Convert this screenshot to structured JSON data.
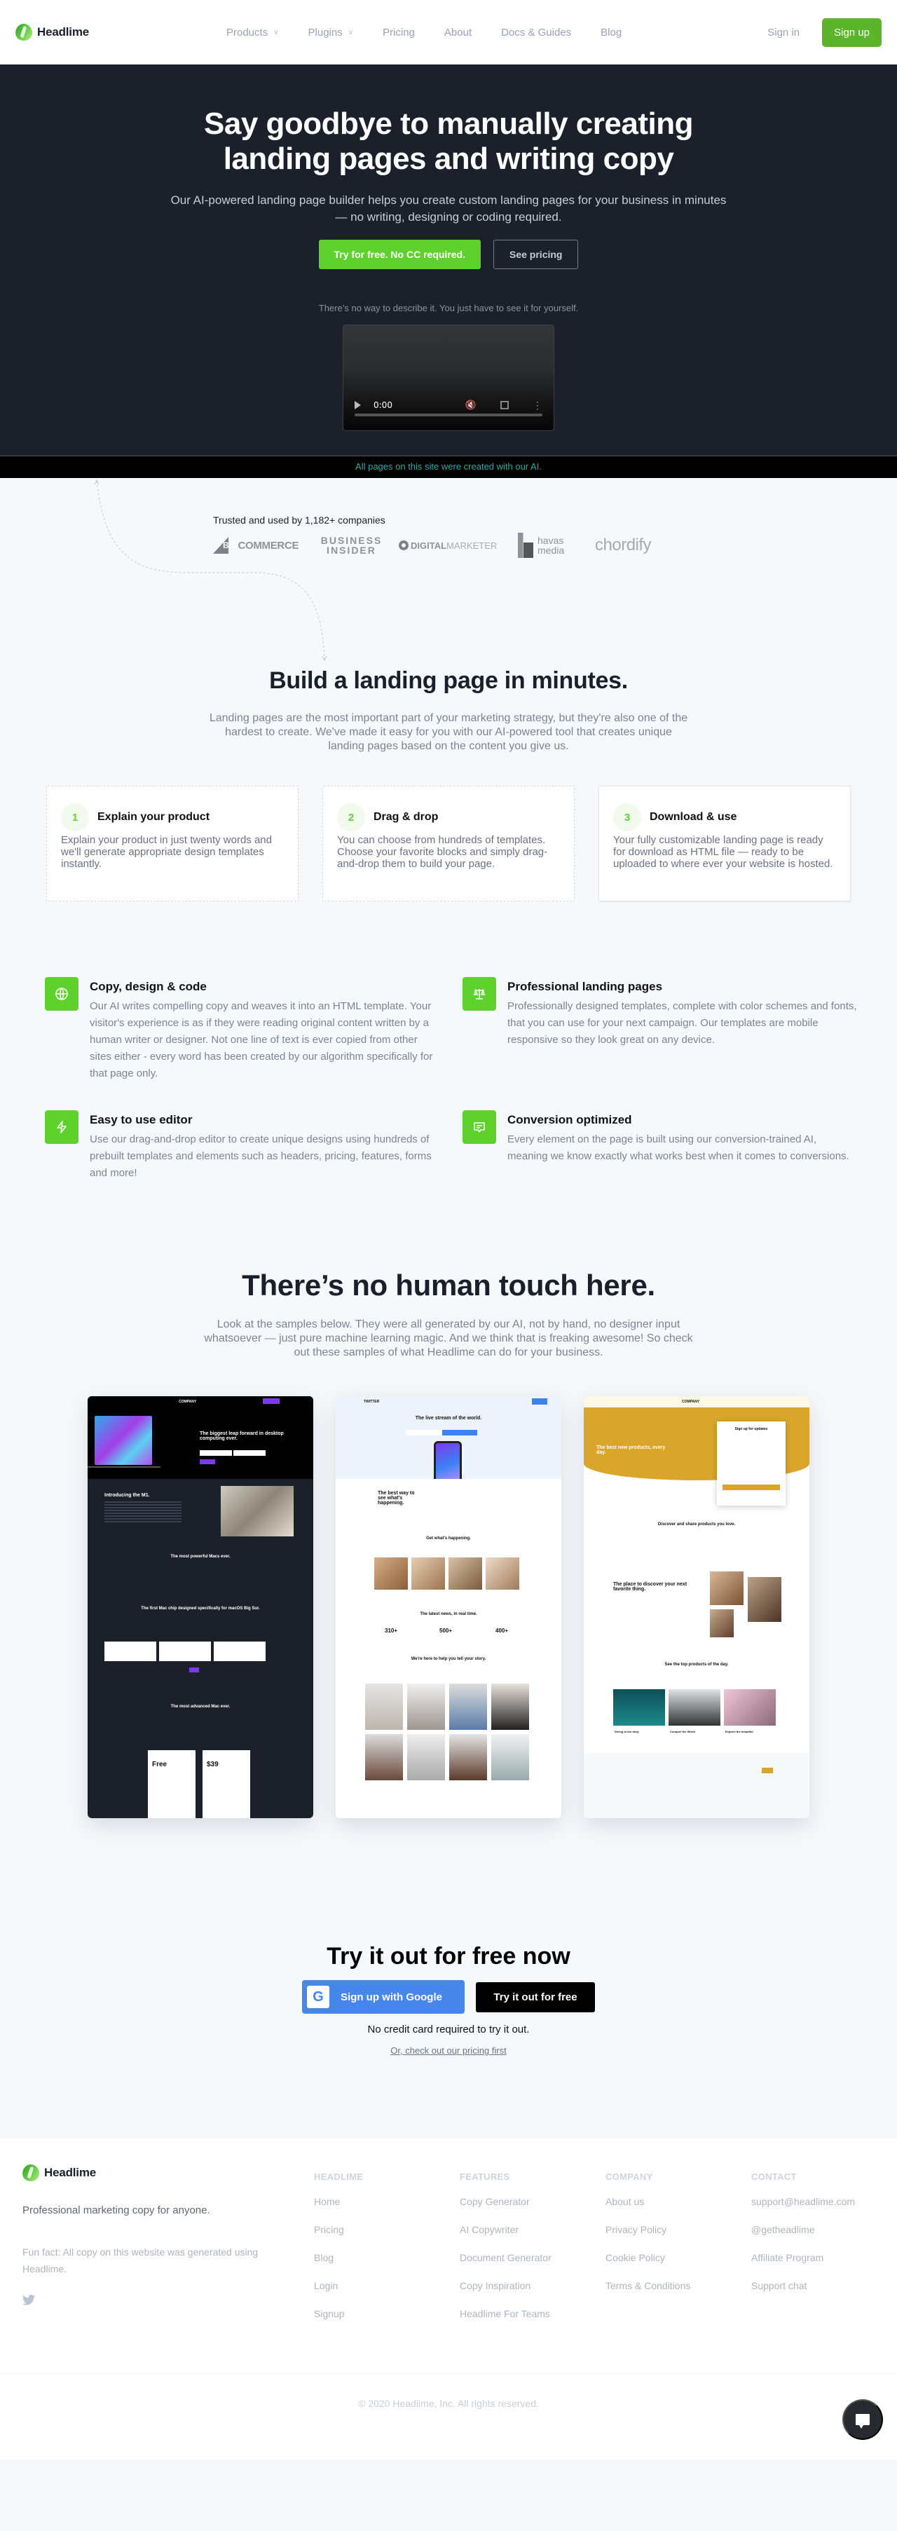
{
  "brand": {
    "name": "Headlime",
    "accent_color": "#5fd12d"
  },
  "nav": {
    "links": [
      {
        "label": "Products",
        "dropdown": true
      },
      {
        "label": "Plugins",
        "dropdown": true
      },
      {
        "label": "Pricing",
        "dropdown": false
      },
      {
        "label": "About",
        "dropdown": false
      },
      {
        "label": "Docs & Guides",
        "dropdown": false
      },
      {
        "label": "Blog",
        "dropdown": false
      }
    ],
    "signin": "Sign in",
    "signup": "Sign up"
  },
  "hero": {
    "title": "Say goodbye to manually creating landing pages and writing copy",
    "subtitle": "Our AI-powered landing page builder helps you create custom landing pages for your business in minutes — no writing, designing or coding required.",
    "primary_cta": "Try for free. No CC required.",
    "secondary_cta": "See pricing",
    "video_note": "There’s no way to describe it. You just have to see it for yourself.",
    "video": {
      "time": "0:00",
      "progress": 0
    },
    "ai_banner": "All pages on this site were created with our AI."
  },
  "trusted": {
    "label": "Trusted and used by 1,182+ companies",
    "logos": [
      {
        "name": "BigCommerce",
        "text_a": "BIG",
        "text_b": "COMMERCE"
      },
      {
        "name": "Business Insider",
        "line1": "BUSINESS",
        "line2": "INSIDER"
      },
      {
        "name": "DigitalMarketer",
        "text_a": "DIGITAL",
        "text_b": "MARKETER"
      },
      {
        "name": "Havas Media",
        "line1": "havas",
        "line2": "media"
      },
      {
        "name": "Chordify",
        "text": "chordify"
      }
    ]
  },
  "build": {
    "title": "Build a landing page in minutes.",
    "subtitle": "Landing pages are the most important part of your marketing strategy, but they're also one of the hardest to create. We've made it easy for you with our AI-powered tool that creates unique landing pages based on the content you give us.",
    "steps": [
      {
        "num": "1",
        "title": "Explain your product",
        "desc": "Explain your product in just twenty words and we'll generate appropriate design templates instantly."
      },
      {
        "num": "2",
        "title": "Drag & drop",
        "desc": "You can choose from hundreds of templates. Choose your favorite blocks and simply drag-and-drop them to build your page."
      },
      {
        "num": "3",
        "title": "Download & use",
        "desc": "Your fully customizable landing page is ready for download as HTML file — ready to be uploaded to where ever your website is hosted."
      }
    ]
  },
  "features": [
    {
      "icon": "globe-icon",
      "title": "Copy, design & code",
      "desc": "Our AI writes compelling copy and weaves it into an HTML template. Your visitor's experience is as if they were reading original content written by a human writer or designer. Not one line of text is ever copied from other sites either - every word has been created by our algorithm specifically for that page only."
    },
    {
      "icon": "scale-icon",
      "title": "Professional landing pages",
      "desc": "Professionally designed templates, complete with color schemes and fonts, that you can use for your next campaign. Our templates are mobile responsive so they look great on any device."
    },
    {
      "icon": "lightning-icon",
      "title": "Easy to use editor",
      "desc": "Use our drag-and-drop editor to create unique designs using hundreds of prebuilt templates and elements such as headers, pricing, features, forms and more!"
    },
    {
      "icon": "message-icon",
      "title": "Conversion optimized",
      "desc": "Every element on the page is built using our conversion-trained AI, meaning we know exactly what works best when it comes to conversions."
    }
  ],
  "samples": {
    "title": "There’s no human touch here.",
    "subtitle": "Look at the samples below. They were all generated by our AI, not by hand, no designer input whatsoever — just pure machine learning magic. And we think that is freaking awesome! So check out these samples of what Headlime can do for your business.",
    "items": [
      {
        "theme": "dark",
        "brand": "COMPANY",
        "hero": "The biggest leap forward in desktop computing ever.",
        "sections": [
          "Introducing the M1.",
          "The most powerful Macs ever.",
          "The first Mac chip designed specifically for macOS Big Sur.",
          "The most advanced Mac ever."
        ],
        "prices": [
          "Free",
          "$39"
        ]
      },
      {
        "theme": "light",
        "brand": "TWITTER",
        "hero": "The live stream of the world.",
        "sections": [
          "The best way to see what's happening.",
          "Get what's happening.",
          "The latest news, in real time.",
          "We're here to help you tell your story."
        ],
        "stats": [
          "310+",
          "500+",
          "400+"
        ]
      },
      {
        "theme": "yellow",
        "brand": "COMPANY",
        "hero": "The best new products, every day.",
        "form_title": "Sign up for updates",
        "sections": [
          "Discover and share products you love.",
          "The place to discover your next favorite thing.",
          "See the top products of the day."
        ],
        "cards": [
          "Diving to the deep",
          "Conquer the World",
          "Explore the beautiful"
        ]
      }
    ]
  },
  "cta": {
    "title": "Try it out for free now",
    "google_button": "Sign up with Google",
    "free_button": "Try it out for free",
    "note": "No credit card required to try it out.",
    "pricing_link": "Or, check out our pricing first"
  },
  "footer": {
    "tagline": "Professional marketing copy for anyone.",
    "fun_fact": "Fun fact: All copy on this website was generated using Headlime.",
    "columns": [
      {
        "heading": "HEADLIME",
        "links": [
          "Home",
          "Pricing",
          "Blog",
          "Login",
          "Signup"
        ]
      },
      {
        "heading": "FEATURES",
        "links": [
          "Copy Generator",
          "AI Copywriter",
          "Document Generator",
          "Copy Inspiration",
          "Headlime For Teams"
        ]
      },
      {
        "heading": "COMPANY",
        "links": [
          "About us",
          "Privacy Policy",
          "Cookie Policy",
          "Terms & Conditions"
        ]
      },
      {
        "heading": "CONTACT",
        "links": [
          "support@headlime.com",
          "@getheadlime",
          "Affiliate Program",
          "Support chat"
        ]
      }
    ],
    "copyright": "© 2020 Headlime, Inc. All rights reserved."
  }
}
